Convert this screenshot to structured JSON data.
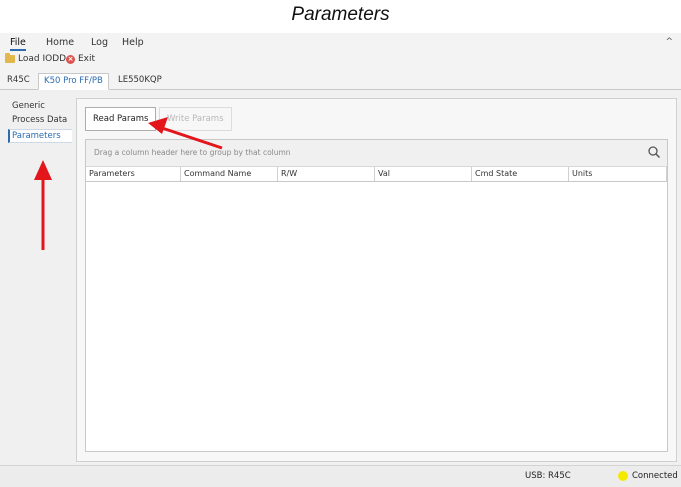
{
  "caption": "Parameters",
  "menu": {
    "file": "File",
    "home": "Home",
    "log": "Log",
    "help": "Help",
    "collapse": "^"
  },
  "ribbon": {
    "load": "Load IODD",
    "exit": "Exit"
  },
  "tabs": [
    "R45C",
    "K50 Pro FF/PB",
    "LE550KQP"
  ],
  "sidenav": [
    "Generic",
    "Process Data",
    "Parameters"
  ],
  "buttons": {
    "read": "Read Params",
    "write": "Write Params"
  },
  "grid": {
    "group_hint": "Drag a column header here to group by that column",
    "columns": [
      "Parameters",
      "Command Name",
      "R/W",
      "Val",
      "Cmd State",
      "Units"
    ]
  },
  "status": {
    "usb": "USB:  R45C",
    "connection": "Connected",
    "connection_color": "#f5e900"
  },
  "colors": {
    "accent": "#2b6cb0",
    "annotation_arrow": "#e3161b"
  }
}
